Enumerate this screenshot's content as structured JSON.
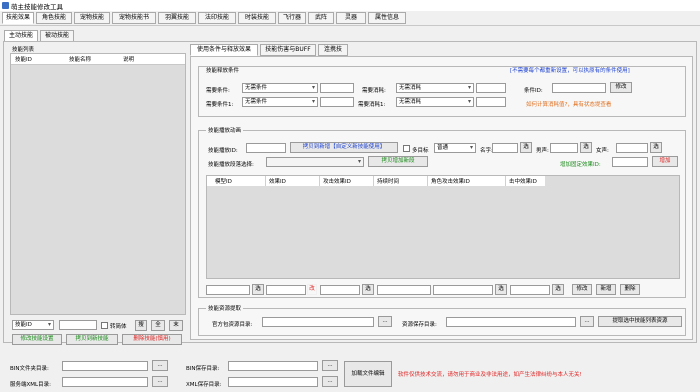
{
  "window": {
    "title": "萌主技能修改工具"
  },
  "top_tabs": [
    "技能效果",
    "角色技能",
    "宠物技能",
    "宠物技能书",
    "羽翼技能",
    "法印技能",
    "时装技能",
    "飞行器",
    "武阵",
    "灵器",
    "属性信息"
  ],
  "sub_tabs": [
    "主动技能",
    "被动技能"
  ],
  "left": {
    "list_title": "技能列表",
    "columns": [
      "技能ID",
      "技能名称",
      "说明"
    ],
    "search_type": "技能ID",
    "cond_label": "转简体",
    "btn_search": "搜",
    "btn_all": "全",
    "btn_end": "末",
    "btn_modify": "修改技能设置",
    "btn_copy_new": "拷贝到新技能",
    "btn_delete": "删除技能(慎用)"
  },
  "inner_tabs": [
    "使用条件与释放效果",
    "技能伤害与BUFF",
    "连携技"
  ],
  "release": {
    "group_title": "技能释放条件",
    "hint": "[不需要每个都重新设置，可以执原有的条件使用]",
    "req1_label": "需要条件:",
    "req1_value": "无需条件",
    "req2_label": "需要条件1:",
    "req2_value": "无需条件",
    "cost1_label": "需要消耗:",
    "cost1_value": "无需消耗",
    "cost2_label": "需要消耗1:",
    "cost2_value": "无需消耗",
    "cond_id_label": "条件ID:",
    "btn_modify": "修改",
    "calc_hint": "如何计算消耗值?，具有状态堤查看"
  },
  "anim": {
    "group_title": "技能播放动画",
    "anim_id_label": "技能播放ID:",
    "btn_copy_new": "拷贝到新增【自定义新技能使用】",
    "multi_target": "多目标",
    "target_value": "普通",
    "name_label": "名字:",
    "btn_sel": "选",
    "male_label": "男声:",
    "female_label": "女声:",
    "seg_label": "技能播放段落选择:",
    "btn_copy_seg": "拷贝增加新段",
    "add_effect_label": "增加固定效果ID:",
    "btn_add": "增加",
    "columns": [
      "模型ID",
      "效果ID",
      "攻击效果ID",
      "持续时间",
      "角色攻击效果ID",
      "击中效果ID"
    ],
    "btn_del_mark": "改",
    "btn_modify": "修改",
    "btn_new": "新增",
    "btn_delete": "删除"
  },
  "resource": {
    "group_title": "技能资源提取",
    "src_label": "官方包资源目录:",
    "save_label": "资源保存目录:",
    "btn_browse": "...",
    "btn_extract": "提取选中技能列表资源"
  },
  "bottom": {
    "bin_dir_label": "BIN文件夹目录:",
    "xml_dir_label": "服务端XML目录:",
    "bin_save_label": "BIN保存目录:",
    "xml_save_label": "XML保存目录:",
    "btn_browse": "...",
    "btn_load": "加载文件编辑",
    "notice": "软件仅供技术交流，请勿用于商业及非法用途，如产生法律纠纷与本人无关!"
  }
}
